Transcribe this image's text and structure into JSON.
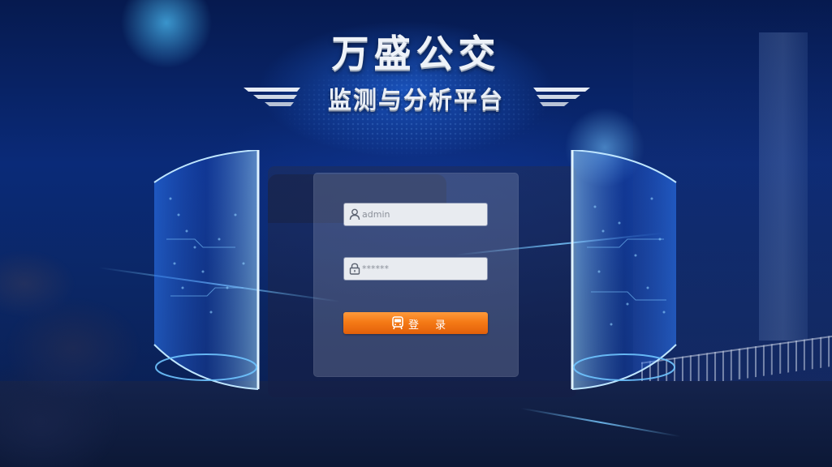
{
  "header": {
    "title": "万盛公交",
    "subtitle": "监测与分析平台"
  },
  "login": {
    "username_value": "admin",
    "password_value": "******",
    "submit_label": "登 录"
  },
  "icons": {
    "username": "user-icon",
    "password": "lock-icon",
    "submit": "bus-icon"
  },
  "colors": {
    "background": "#0a2a78",
    "accent_orange": "#f57a16",
    "field_bg": "#e8ebf0",
    "title_text": "#eef2f8",
    "glow_blue": "#4fb4ff"
  }
}
